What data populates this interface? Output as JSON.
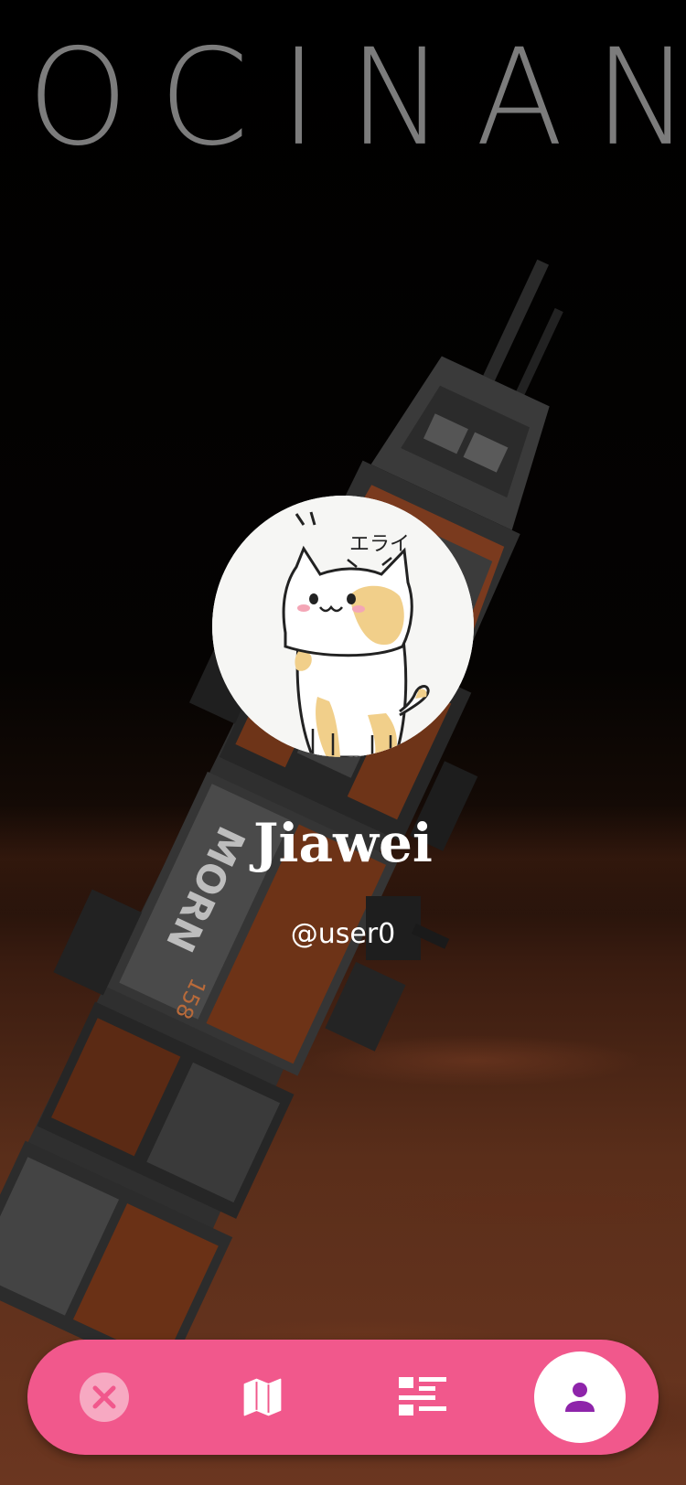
{
  "background": {
    "brand_text": "OCINANT",
    "ship_hull_text": "MORN",
    "ship_hull_number": "158"
  },
  "profile": {
    "avatar_caption": "エライ",
    "display_name": "Jiawei",
    "username": "@user0"
  },
  "bottom_nav": {
    "items": [
      {
        "icon": "close-icon",
        "active": false
      },
      {
        "icon": "map-icon",
        "active": false
      },
      {
        "icon": "list-icon",
        "active": false
      },
      {
        "icon": "person-icon",
        "active": true
      }
    ]
  },
  "colors": {
    "nav_background": "#f1588c",
    "nav_icon": "#ffffff",
    "active_icon": "#8e24aa",
    "close_circle": "#f7a9c2"
  }
}
